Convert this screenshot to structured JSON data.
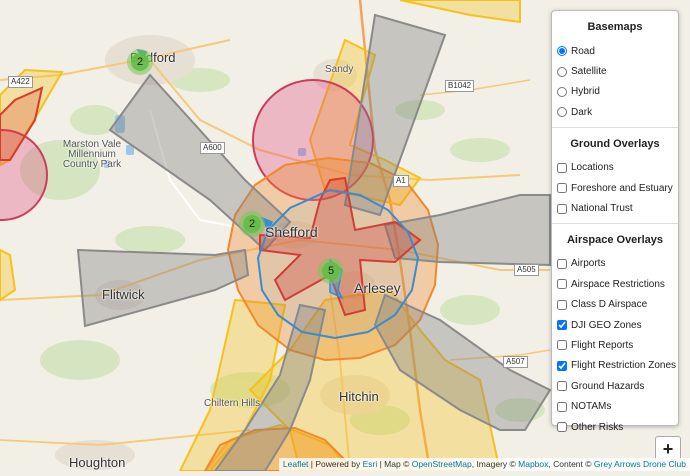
{
  "map": {
    "places": [
      {
        "id": "bedford",
        "label": "Bedford"
      },
      {
        "id": "sandy",
        "label": "Sandy"
      },
      {
        "id": "marston",
        "label": "Marston Vale Millennium Country Park"
      },
      {
        "id": "shefford",
        "label": "Shefford"
      },
      {
        "id": "flitwick",
        "label": "Flitwick"
      },
      {
        "id": "arlesey",
        "label": "Arlesey"
      },
      {
        "id": "chiltern",
        "label": "Chiltern Hills"
      },
      {
        "id": "hitchin",
        "label": "Hitchin"
      },
      {
        "id": "houghton",
        "label": "Houghton"
      }
    ],
    "roads": [
      {
        "id": "a422",
        "label": "A422"
      },
      {
        "id": "b1042",
        "label": "B1042"
      },
      {
        "id": "a600",
        "label": "A600"
      },
      {
        "id": "a1",
        "label": "A1"
      },
      {
        "id": "a505",
        "label": "A505"
      },
      {
        "id": "a507",
        "label": "A507"
      }
    ],
    "clusters": [
      {
        "id": "bedford",
        "count": "2"
      },
      {
        "id": "shefford",
        "count": "2"
      },
      {
        "id": "arlesey",
        "count": "5"
      }
    ]
  },
  "panel": {
    "basemaps": {
      "title": "Basemaps",
      "options": [
        {
          "label": "Road",
          "checked": true
        },
        {
          "label": "Satellite",
          "checked": false
        },
        {
          "label": "Hybrid",
          "checked": false
        },
        {
          "label": "Dark",
          "checked": false
        }
      ]
    },
    "ground": {
      "title": "Ground Overlays",
      "options": [
        {
          "label": "Locations",
          "checked": false
        },
        {
          "label": "Foreshore and Estuary",
          "checked": false
        },
        {
          "label": "National Trust",
          "checked": false
        }
      ]
    },
    "airspace": {
      "title": "Airspace Overlays",
      "options": [
        {
          "label": "Airports",
          "checked": false
        },
        {
          "label": "Airspace Restrictions",
          "checked": false
        },
        {
          "label": "Class D Airspace",
          "checked": false
        },
        {
          "label": "DJI GEO Zones",
          "checked": true
        },
        {
          "label": "Flight Reports",
          "checked": false
        },
        {
          "label": "Flight Restriction Zones",
          "checked": true
        },
        {
          "label": "Ground Hazards",
          "checked": false
        },
        {
          "label": "NOTAMs",
          "checked": false
        },
        {
          "label": "Other Risks",
          "checked": false
        }
      ]
    }
  },
  "zoom": {
    "in_label": "+"
  },
  "attribution": {
    "leaflet": "Leaflet",
    "powered": " | Powered by ",
    "esri": "Esri",
    "map": " | Map © ",
    "osm": "OpenStreetMap",
    "imagery": ", Imagery © ",
    "mapbox": "Mapbox",
    "content": ", Content © ",
    "club": "Grey Arrows Drone Club"
  },
  "colors": {
    "grey_zone": "#8a8a8a",
    "yellow_zone": "#f5c21a",
    "orange_zone": "#ee8a2c",
    "red_zone": "#d93a2a",
    "pink_zone": "#e0457a",
    "blue_zone": "#3a8bd0"
  }
}
